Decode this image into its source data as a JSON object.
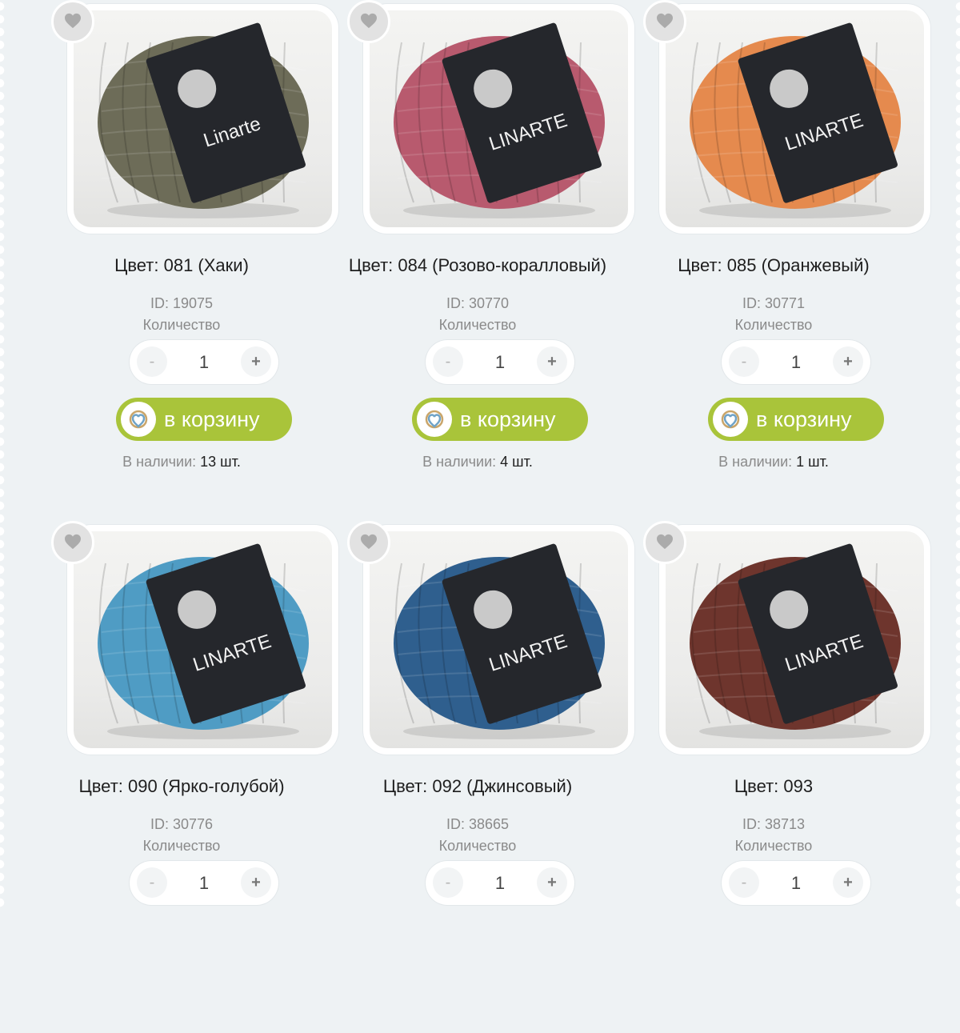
{
  "colors": {
    "accent_green": "#a9c43a",
    "page_background": "#eef2f4",
    "muted_text": "#8a8a8a"
  },
  "products": [
    {
      "title": "Цвет: 081 (Хаки)",
      "id_text": "ID: 19075",
      "qty_label": "Количество",
      "qty": "1",
      "minus": "-",
      "plus": "+",
      "cart_label": "в корзину",
      "stock_label": "В наличии:",
      "stock_value": "13 шт.",
      "yarn_color": "#6d6c58",
      "band_text": "Linarte",
      "fav_icon": "heart-icon"
    },
    {
      "title": "Цвет: 084 (Розово-коралловый)",
      "id_text": "ID: 30770",
      "qty_label": "Количество",
      "qty": "1",
      "minus": "-",
      "plus": "+",
      "cart_label": "в корзину",
      "stock_label": "В наличии:",
      "stock_value": "4 шт.",
      "yarn_color": "#b85a6e",
      "band_text": "LINARTE",
      "fav_icon": "heart-icon"
    },
    {
      "title": "Цвет: 085 (Оранжевый)",
      "id_text": "ID: 30771",
      "qty_label": "Количество",
      "qty": "1",
      "minus": "-",
      "plus": "+",
      "cart_label": "в корзину",
      "stock_label": "В наличии:",
      "stock_value": "1 шт.",
      "yarn_color": "#e58a4e",
      "band_text": "LINARTE",
      "fav_icon": "heart-icon"
    },
    {
      "title": "Цвет: 090 (Ярко-голубой)",
      "id_text": "ID: 30776",
      "qty_label": "Количество",
      "qty": "1",
      "minus": "-",
      "plus": "+",
      "yarn_color": "#4f9cc4",
      "band_text": "LINARTE",
      "fav_icon": "heart-icon"
    },
    {
      "title": "Цвет: 092 (Джинсовый)",
      "id_text": "ID: 38665",
      "qty_label": "Количество",
      "qty": "1",
      "minus": "-",
      "plus": "+",
      "yarn_color": "#2f5f8e",
      "band_text": "LINARTE",
      "fav_icon": "heart-icon"
    },
    {
      "title": "Цвет: 093",
      "id_text": "ID: 38713",
      "qty_label": "Количество",
      "qty": "1",
      "minus": "-",
      "plus": "+",
      "yarn_color": "#6e352d",
      "band_text": "LINARTE",
      "fav_icon": "heart-icon"
    }
  ]
}
